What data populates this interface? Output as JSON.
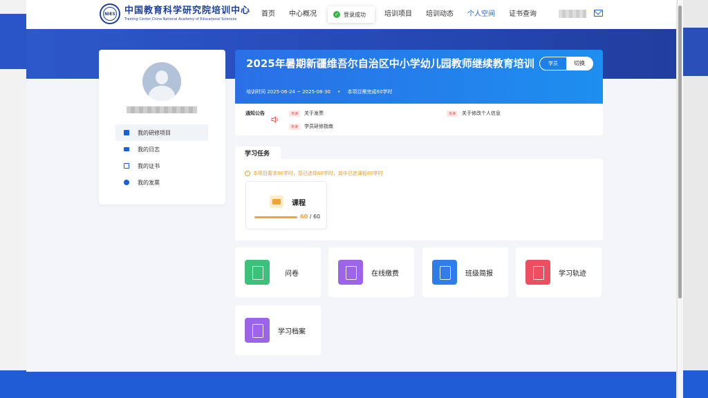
{
  "brand": {
    "name_cn": "中国教育科学研究院培训中心",
    "name_en": "Training Center,China National Academy of Educational Sciences"
  },
  "nav": {
    "items": [
      "首页",
      "中心概况",
      "登录成功",
      "培训项目",
      "培训动态",
      "个人空间",
      "证书查询"
    ],
    "active": "个人空间"
  },
  "toast": {
    "text": "登录成功"
  },
  "sidebar": {
    "items": [
      {
        "label": "我的研修项目",
        "icon": "project-icon",
        "color": "#1a5fdb"
      },
      {
        "label": "我的日志",
        "icon": "log-icon",
        "color": "#1a5fdb"
      },
      {
        "label": "我的证书",
        "icon": "certificate-icon",
        "color": "#1a5fdb"
      },
      {
        "label": "我的发票",
        "icon": "invoice-icon",
        "color": "#1a5fdb"
      }
    ]
  },
  "project": {
    "title": "2025年暑期新疆维吾尔自治区中小学幼儿园教师继续教育培训",
    "period": "培训时间 2025-06-24 ~ 2025-08-30",
    "requirement": "本项目需完成60学时",
    "role": "学员",
    "switch_label": "切换"
  },
  "notice": {
    "label": "通知公告",
    "unread_badge": "未读",
    "items": [
      {
        "text": "关于发票"
      },
      {
        "text": "关于修改个人信息"
      },
      {
        "text": "学员研修指南"
      }
    ]
  },
  "tasks": {
    "tab_label": "学习任务",
    "tip": "本项目要求60学时，您已选择60学时，其中已选课程60学时",
    "course": {
      "name": "课程",
      "done": "60",
      "total": "60",
      "progress": 1.0
    }
  },
  "tiles": [
    {
      "label": "问卷",
      "icon": "questionnaire-icon",
      "color": "#3cc07a"
    },
    {
      "label": "在线缴费",
      "icon": "payment-icon",
      "color": "#9c64e6"
    },
    {
      "label": "班级简报",
      "icon": "bulletin-icon",
      "color": "#2f7de8"
    },
    {
      "label": "学习轨迹",
      "icon": "trajectory-icon",
      "color": "#ec4f5f"
    },
    {
      "label": "学习档案",
      "icon": "archive-icon",
      "color": "#9c64e6"
    }
  ]
}
